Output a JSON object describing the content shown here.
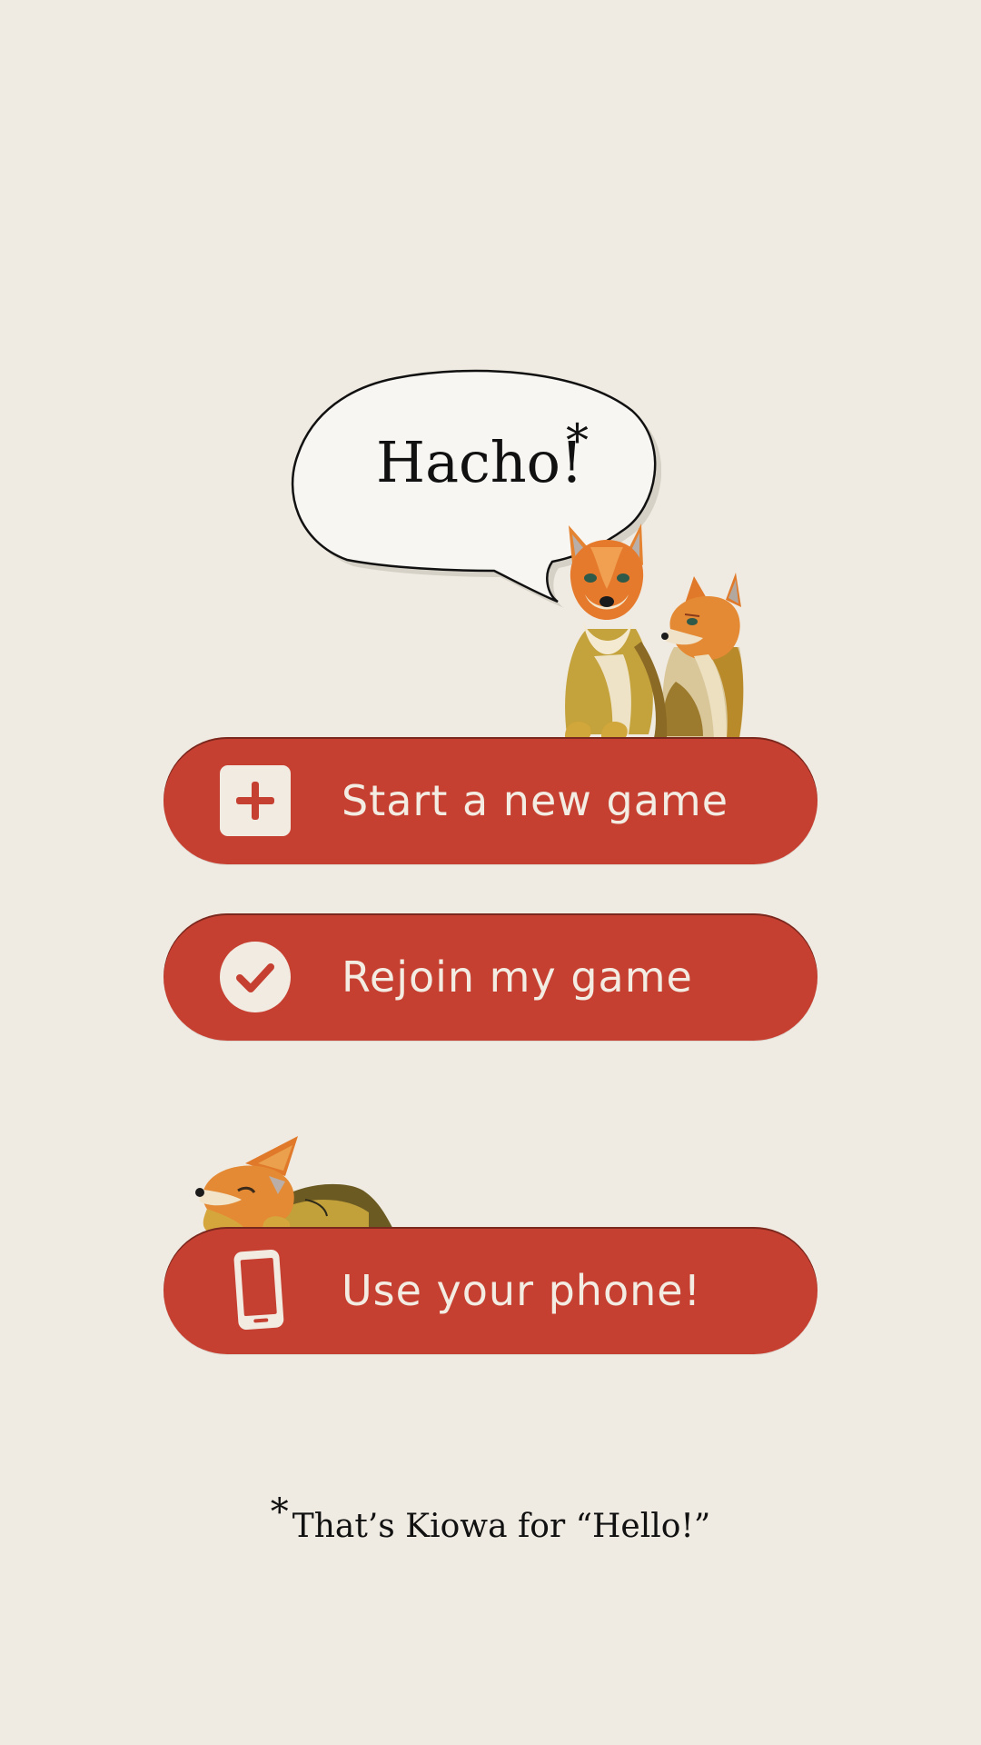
{
  "greeting": {
    "text": "Hacho!",
    "asterisk": "*"
  },
  "buttons": {
    "new_game": {
      "label": "Start a new game",
      "icon": "plus-square-icon"
    },
    "rejoin": {
      "label": "Rejoin my game",
      "icon": "checkmark-circle-icon"
    },
    "phone": {
      "label": "Use your phone!",
      "icon": "phone-icon"
    }
  },
  "footnote": {
    "asterisk": "*",
    "text": "That’s Kiowa for “Hello!”"
  },
  "colors": {
    "background": "#f0ebe2",
    "button": "#c64032",
    "button_text": "#f3ece3",
    "text": "#111111"
  }
}
